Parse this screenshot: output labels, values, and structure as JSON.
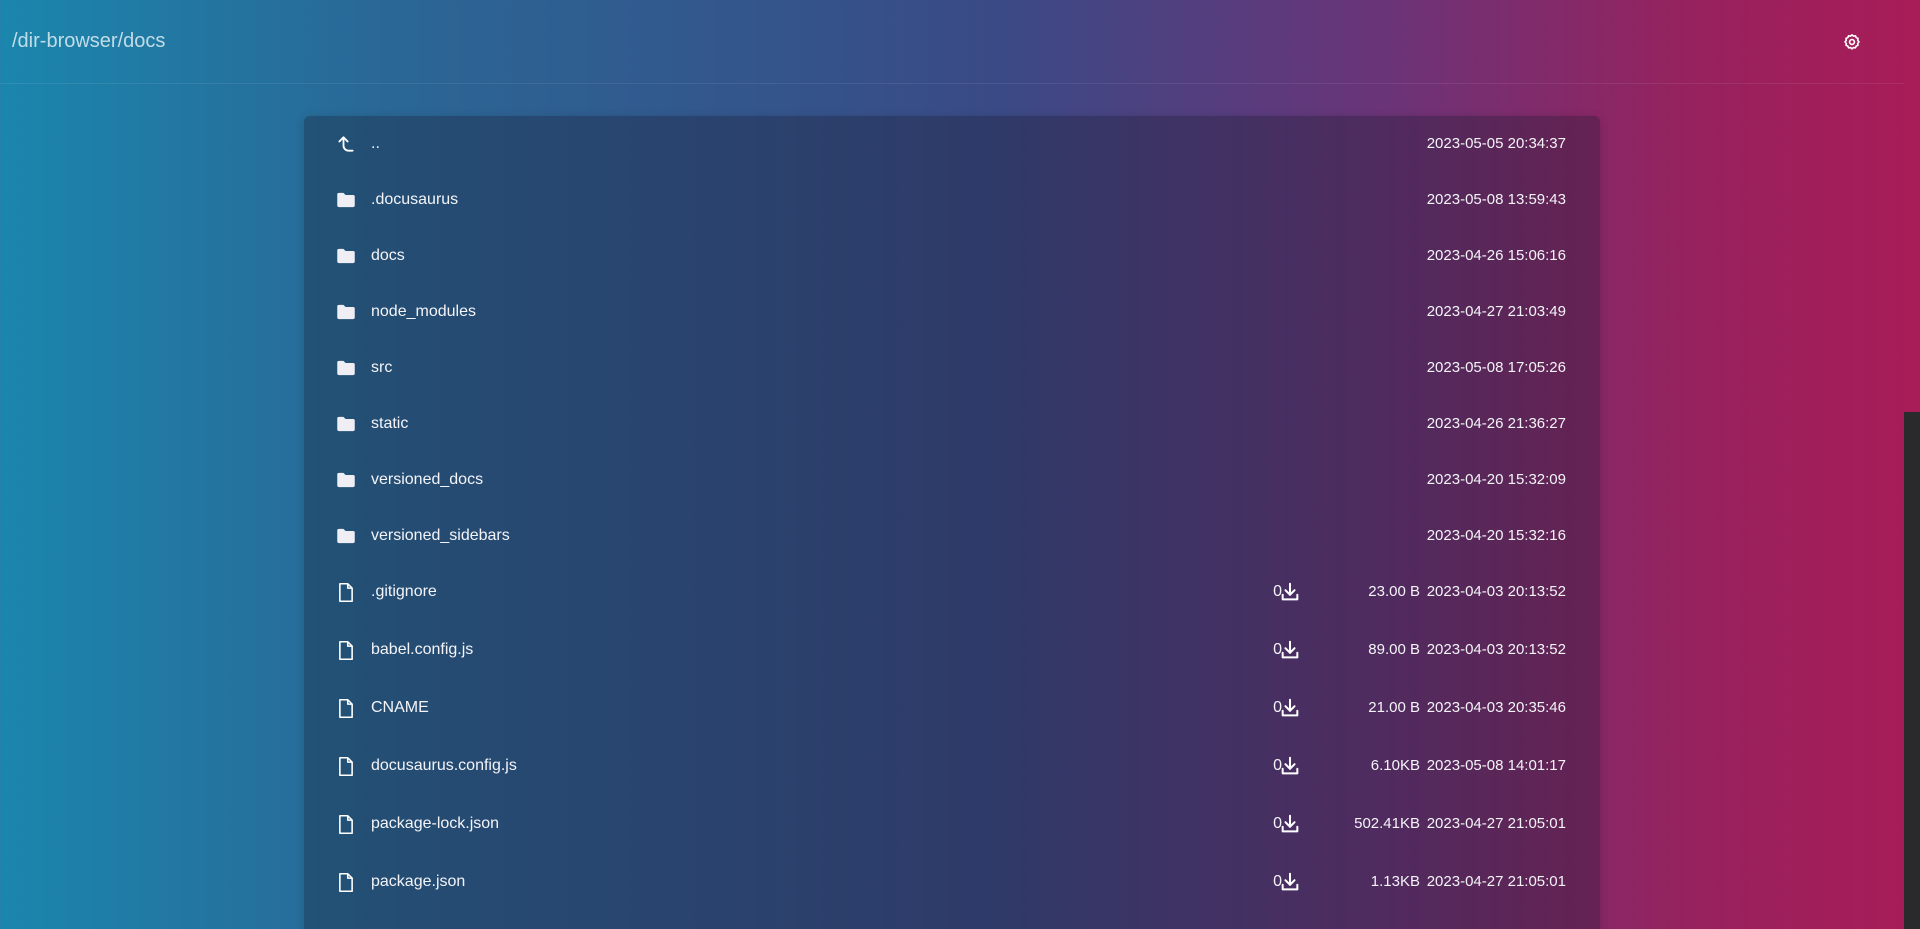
{
  "header": {
    "path": "/dir-browser/docs",
    "settings_icon": "gear-icon"
  },
  "entries": [
    {
      "icon": "parent-directory-icon",
      "name": "..",
      "count": "",
      "size": "",
      "modified": "2023-05-05 20:34:37"
    },
    {
      "icon": "folder-icon",
      "name": ".docusaurus",
      "count": "",
      "size": "",
      "modified": "2023-05-08 13:59:43"
    },
    {
      "icon": "folder-icon",
      "name": "docs",
      "count": "",
      "size": "",
      "modified": "2023-04-26 15:06:16"
    },
    {
      "icon": "folder-icon",
      "name": "node_modules",
      "count": "",
      "size": "",
      "modified": "2023-04-27 21:03:49"
    },
    {
      "icon": "folder-icon",
      "name": "src",
      "count": "",
      "size": "",
      "modified": "2023-05-08 17:05:26"
    },
    {
      "icon": "folder-icon",
      "name": "static",
      "count": "",
      "size": "",
      "modified": "2023-04-26 21:36:27"
    },
    {
      "icon": "folder-icon",
      "name": "versioned_docs",
      "count": "",
      "size": "",
      "modified": "2023-04-20 15:32:09"
    },
    {
      "icon": "folder-icon",
      "name": "versioned_sidebars",
      "count": "",
      "size": "",
      "modified": "2023-04-20 15:32:16"
    },
    {
      "icon": "file-icon",
      "name": ".gitignore",
      "count": "0",
      "size": "23.00 B",
      "modified": "2023-04-03 20:13:52"
    },
    {
      "icon": "file-icon",
      "name": "babel.config.js",
      "count": "0",
      "size": "89.00 B",
      "modified": "2023-04-03 20:13:52"
    },
    {
      "icon": "file-icon",
      "name": "CNAME",
      "count": "0",
      "size": "21.00 B",
      "modified": "2023-04-03 20:35:46"
    },
    {
      "icon": "file-icon",
      "name": "docusaurus.config.js",
      "count": "0",
      "size": "6.10KB",
      "modified": "2023-05-08 14:01:17"
    },
    {
      "icon": "file-icon",
      "name": "package-lock.json",
      "count": "0",
      "size": "502.41KB",
      "modified": "2023-04-27 21:05:01"
    },
    {
      "icon": "file-icon",
      "name": "package.json",
      "count": "0",
      "size": "1.13KB",
      "modified": "2023-04-27 21:05:01"
    }
  ]
}
